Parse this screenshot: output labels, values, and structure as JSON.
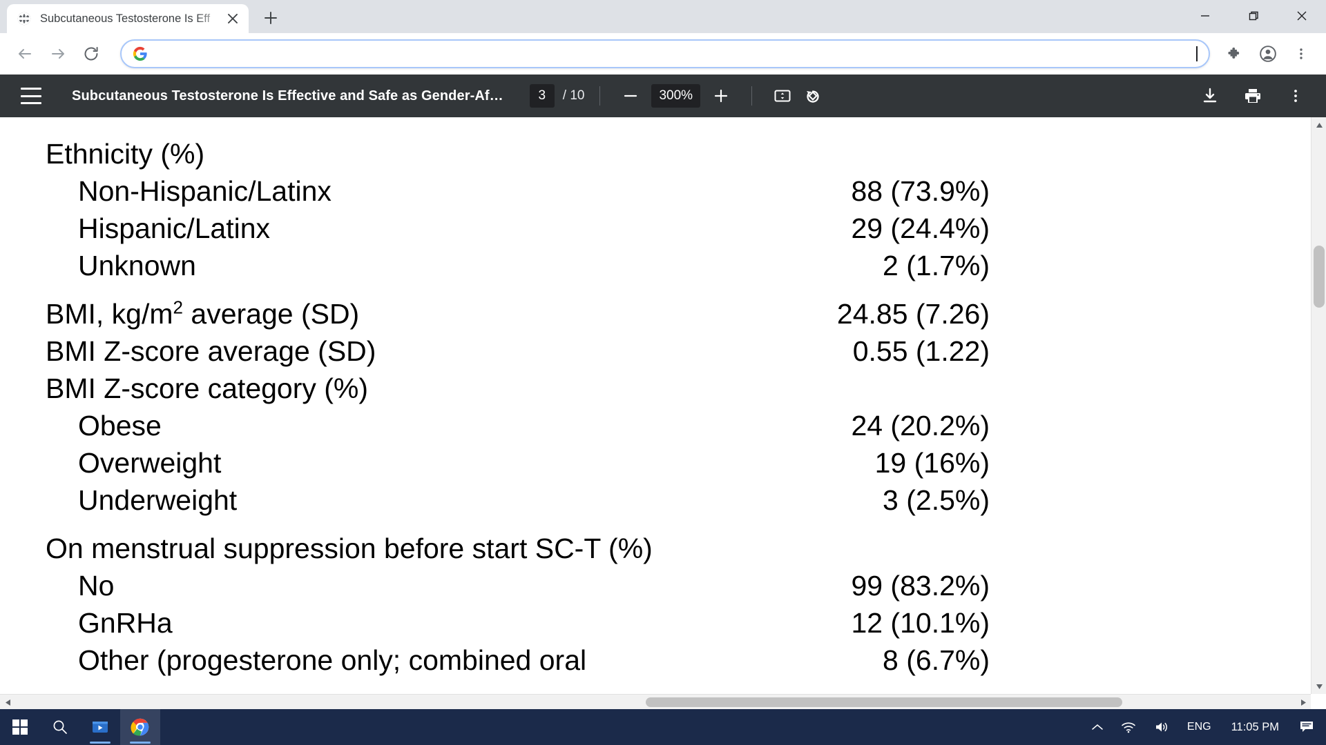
{
  "browser": {
    "tab": {
      "title": "Subcutaneous Testosterone Is Eff",
      "favicon_icon": "globe-icon",
      "close_icon": "close-icon"
    },
    "new_tab_icon": "plus-icon",
    "window_controls": {
      "minimize_icon": "minimize-icon",
      "maximize_icon": "restore-icon",
      "close_icon": "close-icon"
    },
    "nav": {
      "back_icon": "back-arrow-icon",
      "forward_icon": "forward-arrow-icon",
      "reload_icon": "reload-icon"
    },
    "omnibox": {
      "value": "",
      "placeholder": "",
      "leading_icon": "google-g-icon"
    },
    "actions": {
      "extensions_icon": "puzzle-piece-icon",
      "profile_icon": "account-avatar-icon",
      "menu_icon": "three-dot-menu-icon"
    }
  },
  "pdf_viewer": {
    "menu_icon": "hamburger-menu-icon",
    "title": "Subcutaneous Testosterone Is Effective and Safe as Gender-Af…",
    "page_current": "3",
    "page_total": "/ 10",
    "zoom_out_icon": "minus-icon",
    "zoom_level": "300%",
    "zoom_in_icon": "plus-icon",
    "fit_page_icon": "fit-to-page-icon",
    "rotate_icon": "rotate-counterclockwise-icon",
    "download_icon": "download-icon",
    "print_icon": "print-icon",
    "more_icon": "three-dot-menu-icon",
    "scroll": {
      "up_icon": "scroll-up-arrow-icon",
      "down_icon": "scroll-down-arrow-icon",
      "left_icon": "scroll-left-arrow-icon",
      "right_icon": "scroll-right-arrow-icon"
    }
  },
  "document": {
    "rows": [
      {
        "label": "Ethnicity (%)",
        "value": "",
        "indent": false
      },
      {
        "label": "Non-Hispanic/Latinx",
        "value": "88 (73.9%)",
        "indent": true
      },
      {
        "label": "Hispanic/Latinx",
        "value": "29 (24.4%)",
        "indent": true
      },
      {
        "label": "Unknown",
        "value": "2 (1.7%)",
        "indent": true
      },
      {
        "label": "BMI, kg/m",
        "sup": "2",
        "label_after": " average (SD)",
        "value": "24.85 (7.26)",
        "indent": false,
        "spaced": true
      },
      {
        "label": "BMI Z-score average (SD)",
        "value": "0.55 (1.22)",
        "indent": false
      },
      {
        "label": "BMI Z-score category (%)",
        "value": "",
        "indent": false
      },
      {
        "label": "Obese",
        "value": "24 (20.2%)",
        "indent": true
      },
      {
        "label": "Overweight",
        "value": "19 (16%)",
        "indent": true
      },
      {
        "label": "Underweight",
        "value": "3 (2.5%)",
        "indent": true
      },
      {
        "label": "On menstrual suppression before start SC-T (%)",
        "value": "",
        "indent": false,
        "spaced": true
      },
      {
        "label": "No",
        "value": "99 (83.2%)",
        "indent": true
      },
      {
        "label": "GnRHa",
        "value": "12 (10.1%)",
        "indent": true
      },
      {
        "label": "Other (progesterone only; combined oral",
        "value": "8 (6.7%)",
        "indent": true
      }
    ],
    "row_ethnicity_header": "Ethnicity (%)",
    "row_non_hispanic_label": "Non-Hispanic/Latinx",
    "row_non_hispanic_value": "88 (73.9%)",
    "row_hispanic_label": "Hispanic/Latinx",
    "row_hispanic_value": "29 (24.4%)",
    "row_unknown_label": "Unknown",
    "row_unknown_value": "2 (1.7%)",
    "row_bmi_label_pre": "BMI, kg/m",
    "row_bmi_sup": "2",
    "row_bmi_label_post": " average (SD)",
    "row_bmi_value": "24.85 (7.26)",
    "row_bmiz_label": "BMI Z-score average (SD)",
    "row_bmiz_value": "0.55 (1.22)",
    "row_bmizcat_label": "BMI Z-score category (%)",
    "row_obese_label": "Obese",
    "row_obese_value": "24 (20.2%)",
    "row_overweight_label": "Overweight",
    "row_overweight_value": "19 (16%)",
    "row_underweight_label": "Underweight",
    "row_underweight_value": "3 (2.5%)",
    "row_menstrual_label": "On menstrual suppression before start SC-T (%)",
    "row_no_label": "No",
    "row_no_value": "99 (83.2%)",
    "row_gnrha_label": "GnRHa",
    "row_gnrha_value": "12 (10.1%)",
    "row_other_label": "Other (progesterone only; combined oral",
    "row_other_value": "8 (6.7%)"
  },
  "taskbar": {
    "start_icon": "windows-start-icon",
    "search_icon": "search-icon",
    "media_icon": "media-player-icon",
    "chrome_icon": "chrome-icon",
    "tray": {
      "overflow_icon": "chevron-up-icon",
      "network_icon": "wifi-icon",
      "volume_icon": "speaker-icon",
      "language": "ENG",
      "clock": "11:05 PM",
      "notifications_icon": "notification-icon"
    }
  },
  "colors": {
    "chrome_frame": "#dee1e6",
    "pdf_toolbar": "#323639",
    "taskbar": "#1b2a4a",
    "omnibox_border": "#a8c7fa"
  }
}
